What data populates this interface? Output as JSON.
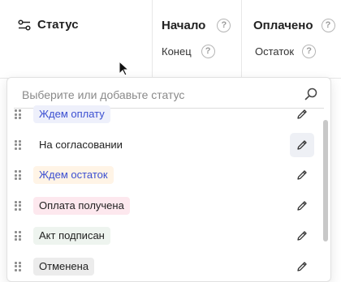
{
  "header": {
    "status_label": "Статус",
    "start_label": "Начало",
    "end_label": "Конец",
    "paid_label": "Оплачено",
    "remaining_label": "Остаток",
    "help_glyph": "?"
  },
  "dropdown": {
    "search_placeholder": "Выберите или добавьте статус",
    "items": [
      {
        "label": "Ждем оплату",
        "text_color": "#3b4fd1",
        "bg_color": "#eef0fb"
      },
      {
        "label": "На согласовании",
        "text_color": "#222222",
        "bg_color": "#ffffff"
      },
      {
        "label": "Ждем остаток",
        "text_color": "#3b4fd1",
        "bg_color": "#fff4e6"
      },
      {
        "label": "Оплата получена",
        "text_color": "#222222",
        "bg_color": "#fde8ee"
      },
      {
        "label": "Акт подписан",
        "text_color": "#222222",
        "bg_color": "#eef4ef"
      },
      {
        "label": "Отменена",
        "text_color": "#222222",
        "bg_color": "#ececec"
      }
    ]
  },
  "icons": {
    "status": "filter-sliders-icon",
    "help": "question-circle-icon",
    "search": "search-icon",
    "edit": "pencil-icon",
    "drag": "drag-handle-icon"
  }
}
